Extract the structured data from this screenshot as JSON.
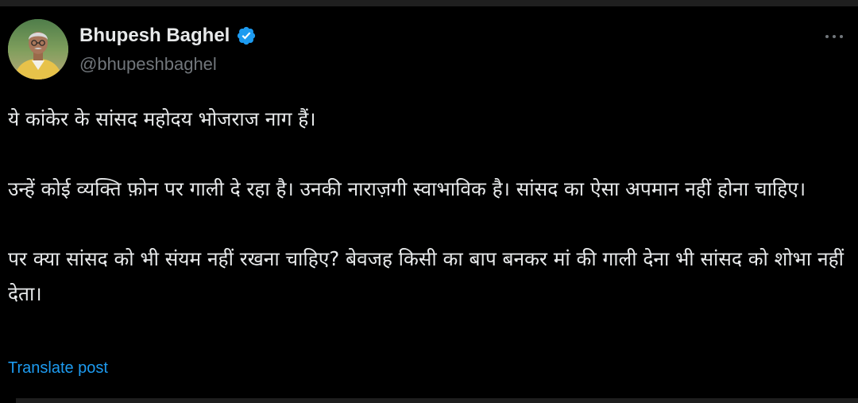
{
  "author": {
    "display_name": "Bhupesh Baghel",
    "handle": "@bhupeshbaghel",
    "verified": true,
    "avatar_icon": "profile-photo",
    "verified_icon": "verified-badge-icon",
    "verified_color": "#1d9bf0"
  },
  "menu": {
    "more_icon": "more-horizontal-icon"
  },
  "tweet": {
    "paragraphs": [
      "ये कांकेर के सांसद महोदय भोजराज नाग हैं।",
      "उन्हें कोई व्यक्ति फ़ोन पर गाली दे रहा है। उनकी नाराज़गी स्वाभाविक है। सांसद का ऐसा अपमान नहीं होना चाहिए।",
      "पर क्या सांसद को भी संयम नहीं रखना चाहिए? बेवजह किसी का बाप बनकर मां की गाली देना भी सांसद को शोभा नहीं देता।"
    ]
  },
  "actions": {
    "translate_label": "Translate post",
    "link_color": "#1d9bf0"
  },
  "theme": {
    "background": "#000000",
    "text_primary": "#e7e9ea",
    "text_secondary": "#71767b"
  }
}
